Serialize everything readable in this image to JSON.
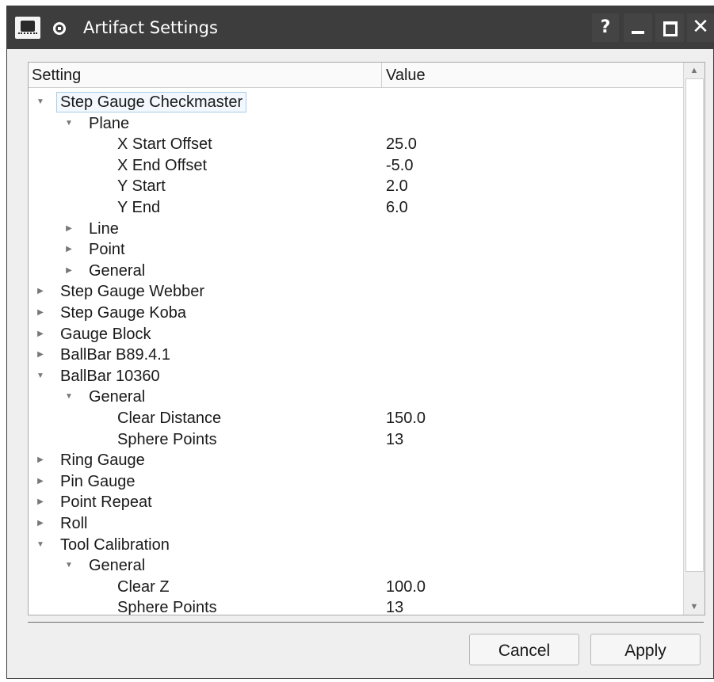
{
  "window": {
    "title": "Artifact Settings",
    "buttons": {
      "help": "?",
      "close": "✕"
    }
  },
  "tree": {
    "headers": {
      "setting": "Setting",
      "value": "Value"
    },
    "rows": [
      {
        "label": "Step Gauge Checkmaster",
        "value": "",
        "level": 0,
        "state": "expanded",
        "selected": true
      },
      {
        "label": "Plane",
        "value": "",
        "level": 1,
        "state": "expanded"
      },
      {
        "label": "X Start Offset",
        "value": "25.0",
        "level": 2,
        "state": "leaf"
      },
      {
        "label": "X End Offset",
        "value": "-5.0",
        "level": 2,
        "state": "leaf"
      },
      {
        "label": "Y Start",
        "value": "2.0",
        "level": 2,
        "state": "leaf"
      },
      {
        "label": "Y End",
        "value": "6.0",
        "level": 2,
        "state": "leaf"
      },
      {
        "label": "Line",
        "value": "",
        "level": 1,
        "state": "collapsed"
      },
      {
        "label": "Point",
        "value": "",
        "level": 1,
        "state": "collapsed"
      },
      {
        "label": "General",
        "value": "",
        "level": 1,
        "state": "collapsed"
      },
      {
        "label": "Step Gauge Webber",
        "value": "",
        "level": 0,
        "state": "collapsed"
      },
      {
        "label": "Step Gauge Koba",
        "value": "",
        "level": 0,
        "state": "collapsed"
      },
      {
        "label": "Gauge Block",
        "value": "",
        "level": 0,
        "state": "collapsed"
      },
      {
        "label": "BallBar B89.4.1",
        "value": "",
        "level": 0,
        "state": "collapsed"
      },
      {
        "label": "BallBar 10360",
        "value": "",
        "level": 0,
        "state": "expanded"
      },
      {
        "label": "General",
        "value": "",
        "level": 1,
        "state": "expanded"
      },
      {
        "label": "Clear Distance",
        "value": "150.0",
        "level": 2,
        "state": "leaf"
      },
      {
        "label": "Sphere Points",
        "value": "13",
        "level": 2,
        "state": "leaf"
      },
      {
        "label": "Ring Gauge",
        "value": "",
        "level": 0,
        "state": "collapsed"
      },
      {
        "label": "Pin Gauge",
        "value": "",
        "level": 0,
        "state": "collapsed"
      },
      {
        "label": "Point Repeat",
        "value": "",
        "level": 0,
        "state": "collapsed"
      },
      {
        "label": "Roll",
        "value": "",
        "level": 0,
        "state": "collapsed"
      },
      {
        "label": "Tool Calibration",
        "value": "",
        "level": 0,
        "state": "expanded"
      },
      {
        "label": "General",
        "value": "",
        "level": 1,
        "state": "expanded"
      },
      {
        "label": "Clear Z",
        "value": "100.0",
        "level": 2,
        "state": "leaf"
      },
      {
        "label": "Sphere Points",
        "value": "13",
        "level": 2,
        "state": "leaf"
      }
    ]
  },
  "footer": {
    "cancel_label": "Cancel",
    "apply_label": "Apply"
  },
  "icons": {
    "expanded": "▼",
    "collapsed": "▶",
    "scroll_up": "▲",
    "scroll_down": "▼"
  },
  "colors": {
    "titlebar": "#3d3d3d",
    "selection_border": "#a9cde8",
    "window_background": "#efefef"
  }
}
